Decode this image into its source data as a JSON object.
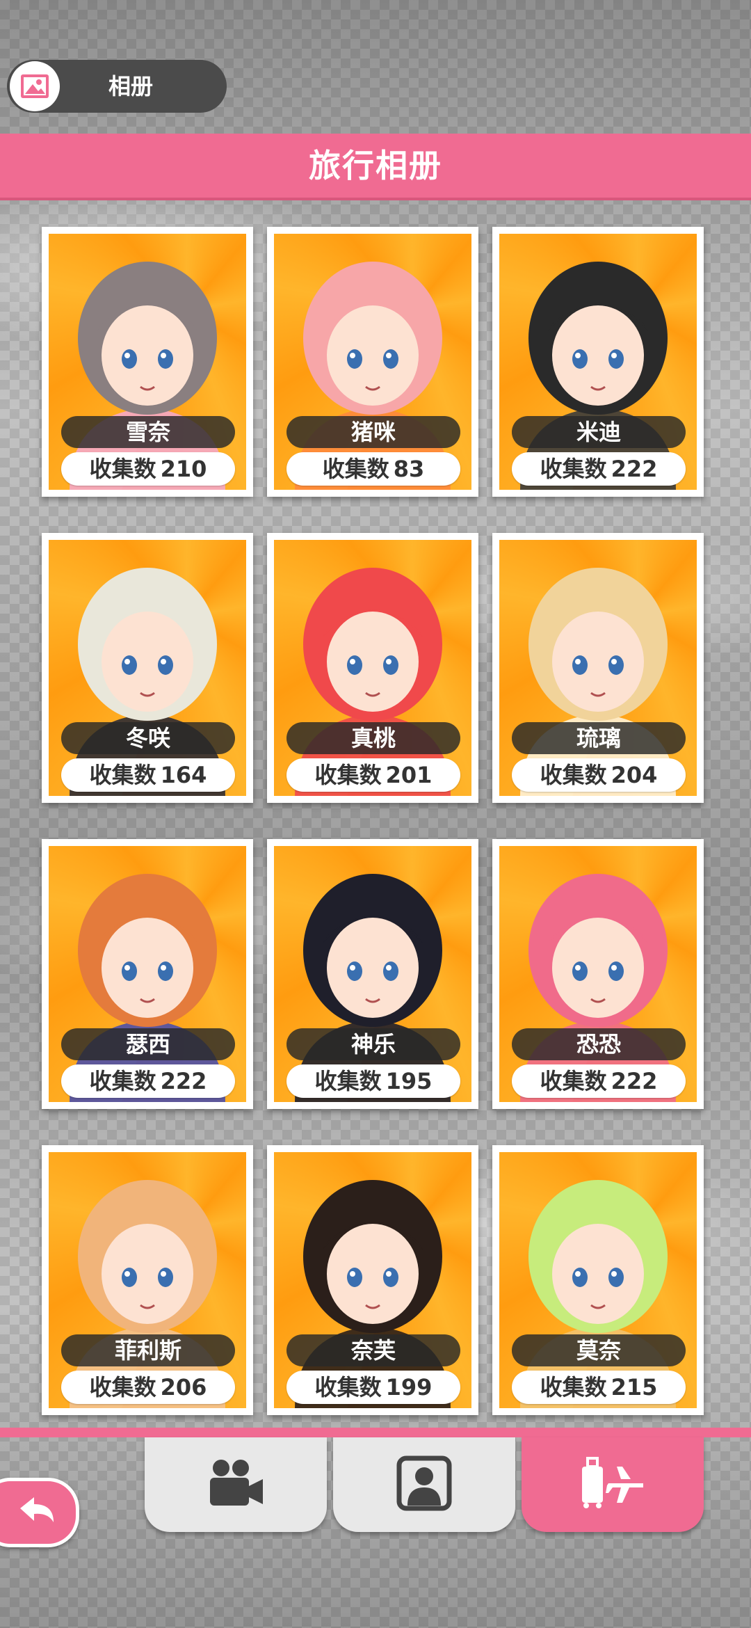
{
  "album_button": {
    "label": "相册",
    "icon": "image-icon"
  },
  "header": {
    "title": "旅行相册"
  },
  "count_label": "收集数",
  "characters": [
    {
      "name": "雪奈",
      "count": "210",
      "hair": "#8a7f80",
      "hood": "#f5a9c6"
    },
    {
      "name": "猪咪",
      "count": "83",
      "hair": "#f7a6a8",
      "hood": "#ff8a3c"
    },
    {
      "name": "米迪",
      "count": "222",
      "hair": "#2a2a2a",
      "hood": "#3b3b3b"
    },
    {
      "name": "冬咲",
      "count": "164",
      "hair": "#e9e7da",
      "hood": "#2e2b33"
    },
    {
      "name": "真桃",
      "count": "201",
      "hair": "#f0494b",
      "hood": "#f0494b"
    },
    {
      "name": "琉璃",
      "count": "204",
      "hair": "#f1d39a",
      "hood": "#fff2d6"
    },
    {
      "name": "瑟西",
      "count": "222",
      "hair": "#e47b3c",
      "hood": "#4d4fa8"
    },
    {
      "name": "神乐",
      "count": "195",
      "hair": "#1f1f2b",
      "hood": "#1f1f2b"
    },
    {
      "name": "恐恐",
      "count": "222",
      "hair": "#f06b8a",
      "hood": "#f06b8a"
    },
    {
      "name": "菲利斯",
      "count": "206",
      "hair": "#f1b47a",
      "hood": "#f4c28e"
    },
    {
      "name": "奈芙",
      "count": "199",
      "hair": "#2b1f1a",
      "hood": "#2b1f1a"
    },
    {
      "name": "莫奈",
      "count": "215",
      "hair": "#c7ec7c",
      "hood": "#f3c36f"
    }
  ],
  "tabs": [
    {
      "name": "tab-video",
      "icon": "video-camera-icon",
      "active": false
    },
    {
      "name": "tab-profile",
      "icon": "person-portrait-icon",
      "active": false
    },
    {
      "name": "tab-travel",
      "icon": "luggage-plane-icon",
      "active": true
    }
  ],
  "back_button": {
    "icon": "back-arrow-icon"
  },
  "colors": {
    "accent": "#f06b92",
    "card_bg": "#ffa11a",
    "pill_dark": "#282828"
  }
}
